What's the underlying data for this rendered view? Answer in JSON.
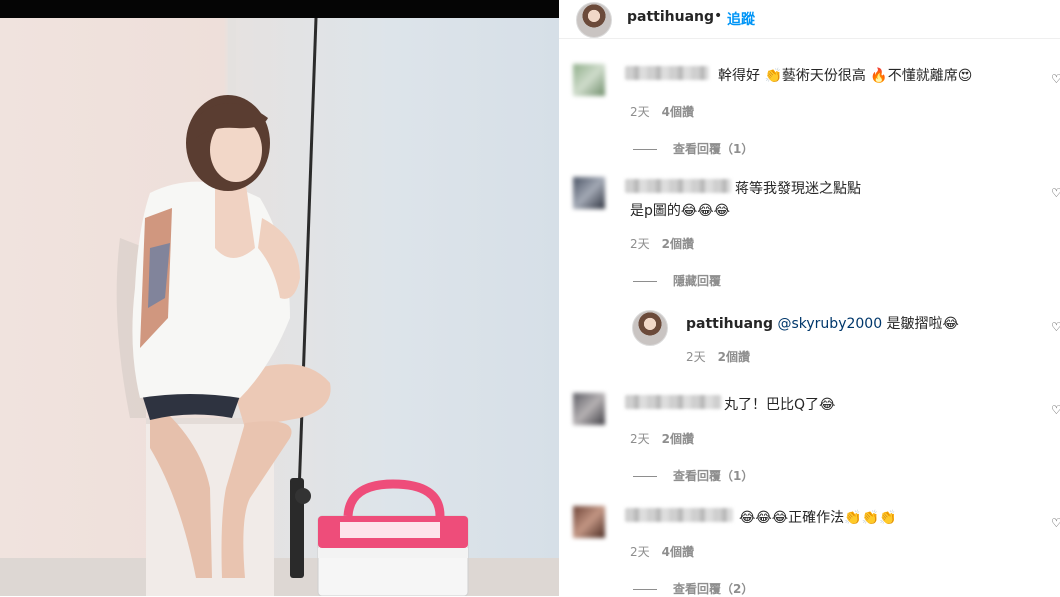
{
  "header": {
    "username": "pattihuang",
    "separator": "•",
    "follow_label": "追蹤"
  },
  "comments": [
    {
      "text": "幹得好 👏藝術天份很高 🔥不懂就離席😍",
      "time": "2天",
      "likes": "4個讚",
      "replies_label": "查看回覆（1）"
    },
    {
      "text": "蒋等我發現迷之點點",
      "text2": "是p圖的😂😂😂",
      "time": "2天",
      "likes": "2個讚",
      "replies_label": "隱藏回覆"
    },
    {
      "text": "丸了！巴比Q了😂",
      "time": "2天",
      "likes": "2個讚",
      "replies_label": "查看回覆（1）"
    },
    {
      "text": "😂😂😂正確作法👏👏👏",
      "time": "2天",
      "likes": "4個讚",
      "replies_label": "查看回覆（2）"
    }
  ],
  "reply": {
    "username": "pattihuang",
    "mention": "@skyruby2000",
    "text": " 是皺摺啦😂",
    "time": "2天",
    "likes": "2個讚"
  },
  "icons": {
    "heart": "heart-icon"
  },
  "colors": {
    "link_blue": "#0095f6",
    "secondary_text": "#8e8e8e",
    "primary_text": "#262626"
  }
}
